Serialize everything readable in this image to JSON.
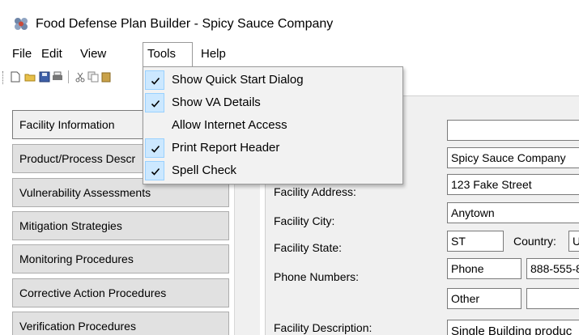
{
  "window": {
    "title": "Food Defense Plan Builder - Spicy Sauce Company",
    "icon": "app-flower-icon"
  },
  "menubar": {
    "items": [
      "File",
      "Edit",
      "View",
      "Tools",
      "Help"
    ]
  },
  "toolbar": {
    "icons": [
      "new-document-icon",
      "open-folder-icon",
      "save-icon",
      "print-icon",
      "cut-icon",
      "copy-icon",
      "paste-icon"
    ]
  },
  "tools_menu": {
    "items": [
      {
        "label": "Show Quick Start Dialog",
        "checked": true
      },
      {
        "label": "Show VA Details",
        "checked": true
      },
      {
        "label": "Allow Internet Access",
        "checked": false
      },
      {
        "label": "Print Report Header",
        "checked": true
      },
      {
        "label": "Spell Check",
        "checked": true
      }
    ]
  },
  "sidebar": {
    "items": [
      "Facility Information",
      "Product/Process Descr",
      "Vulnerability Assessments",
      "Mitigation Strategies",
      "Monitoring Procedures",
      "Corrective Action Procedures",
      "Verification Procedures"
    ],
    "active": "Facility Information"
  },
  "form": {
    "address_label": "Facility Address:",
    "city_label": "Facility City:",
    "state_label": "Facility State:",
    "phone_label": "Phone Numbers:",
    "description_label": "Facility Description:",
    "top_value": "",
    "name_value": "Spicy Sauce Company",
    "address_value": "123 Fake Street",
    "city_value": "Anytown",
    "state_value": "ST",
    "country_label": "Country:",
    "country_value": "U",
    "phone_type_1": "Phone",
    "phone_number_1": "888-555-8",
    "phone_type_2": "Other",
    "phone_number_2": "",
    "description_value": "Single Building produc"
  }
}
